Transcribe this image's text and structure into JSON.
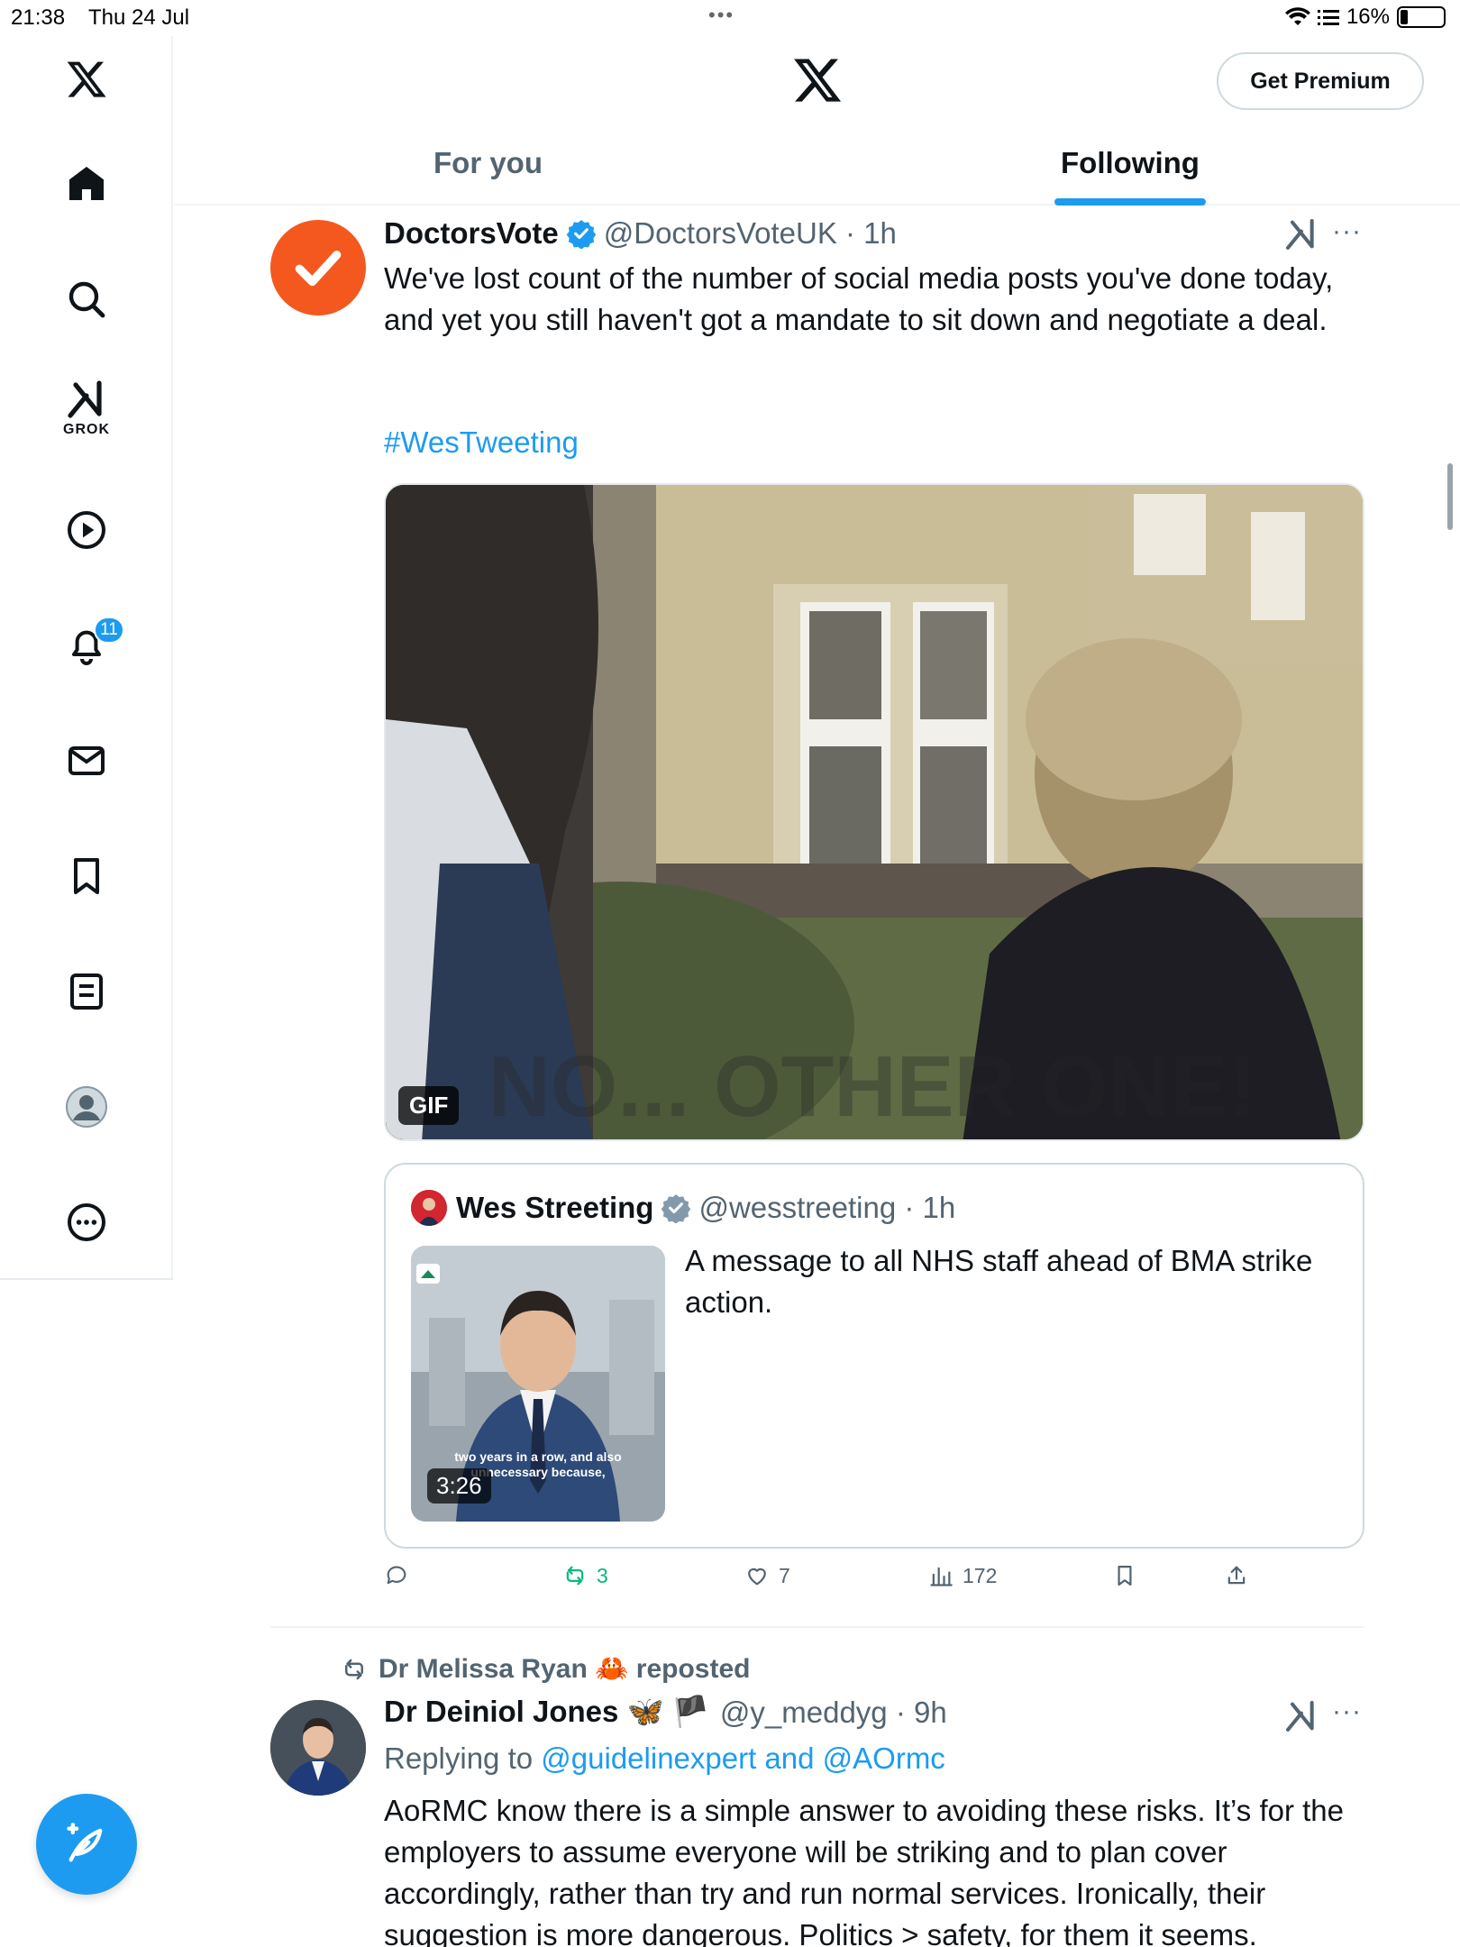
{
  "status_bar": {
    "time": "21:38",
    "date": "Thu 24 Jul",
    "battery": "16%"
  },
  "sidebar": {
    "grok_label": "GROK",
    "notification_count": "11"
  },
  "header": {
    "premium_label": "Get Premium",
    "tabs": [
      {
        "label": "For you",
        "active": false
      },
      {
        "label": "Following",
        "active": true
      }
    ]
  },
  "tweet1": {
    "name": "DoctorsVote",
    "handle": "@DoctorsVoteUK · 1h",
    "text": "We've lost count of the number of social media posts you've done today, and yet you still haven't got a mandate to sit down and negotiate a deal.",
    "hashtag": "#WesTweeting",
    "media_badge": "GIF",
    "quote": {
      "name": "Wes Streeting",
      "handle": "@wesstreeting · 1h",
      "text": "A message to all NHS staff ahead of BMA strike action.",
      "video_caption": "two years in a row, and also unnecessary because,",
      "duration": "3:26"
    },
    "actions": {
      "replies": "",
      "reposts": "3",
      "likes": "7",
      "views": "172"
    }
  },
  "tweet2": {
    "reposted_by": "Dr Melissa Ryan 🦀 reposted",
    "name": "Dr Deiniol Jones 🦋 🏴",
    "handle": "@y_meddyg · 9h",
    "replying_prefix": "Replying to",
    "replying_to": "@guidelinexpert and @AOrmc",
    "text": "AoRMC know there is a simple answer to avoiding these risks. It’s for the employers to assume everyone will be striking and to plan cover accordingly, rather than try and run normal services. Ironically, their suggestion is more dangerous. Politics > safety, for them it seems."
  },
  "colors": {
    "accent": "#1d9bf0",
    "text": "#0f1419",
    "muted": "#536471",
    "repost_active": "#00ba7c",
    "doctorsvote_orange": "#f4581e"
  }
}
